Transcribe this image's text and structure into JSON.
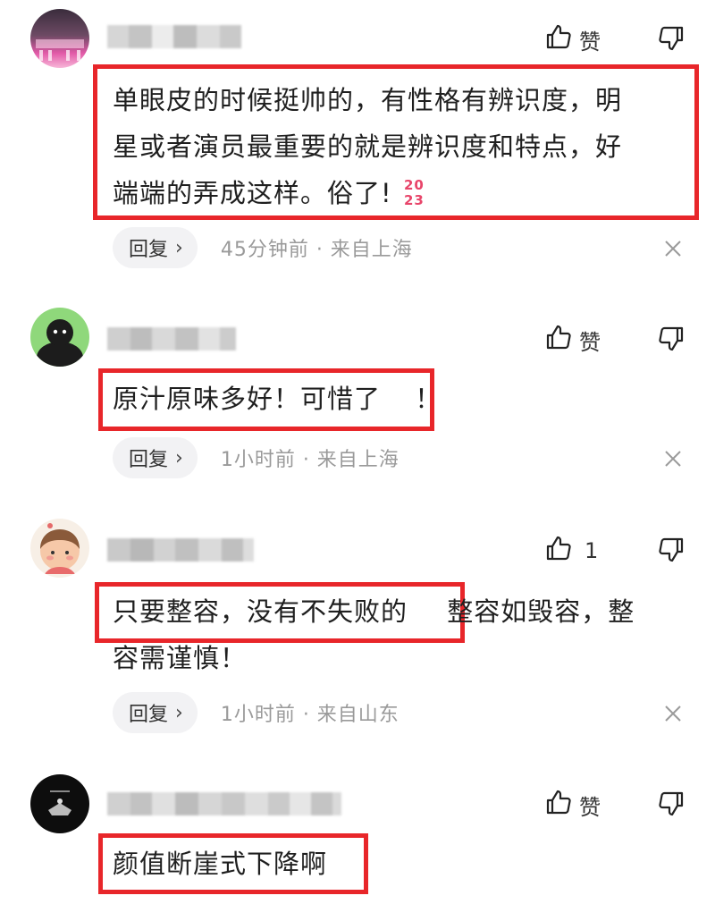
{
  "comments": [
    {
      "username": "",
      "like_label": "赞",
      "text_line1": "单眼皮的时候挺帅的，有性格有辨识度，明",
      "text_line2": "星或者演员最重要的就是辨识度和特点，好",
      "text_line3": "端端的弄成这样。俗了!",
      "emoji": "2023-emoji",
      "reply_label": "回复",
      "meta": "45分钟前 · 来自上海"
    },
    {
      "username": "",
      "like_label": "赞",
      "text_line1": "原汁原味多好！可惜了",
      "text_tail": "！",
      "reply_label": "回复",
      "meta": "1小时前 · 来自上海"
    },
    {
      "username": "",
      "like_label": "1",
      "text_line1a": "只要整容，没有不失败的",
      "text_line1b": "整容如毁容，整",
      "text_line2": "容需谨慎！",
      "reply_label": "回复",
      "meta": "1小时前 · 来自山东"
    },
    {
      "username": "",
      "like_label": "赞",
      "text_line1": "颜值断崖式下降啊"
    }
  ],
  "icons": {
    "like": "thumbs-up-icon",
    "dislike": "thumbs-down-icon",
    "close": "close-icon",
    "chevron": "chevron-right-icon"
  },
  "colors": {
    "highlight_box": "#e8262a",
    "meta_text": "#9a9a9a",
    "reply_bg": "#f2f2f4"
  }
}
